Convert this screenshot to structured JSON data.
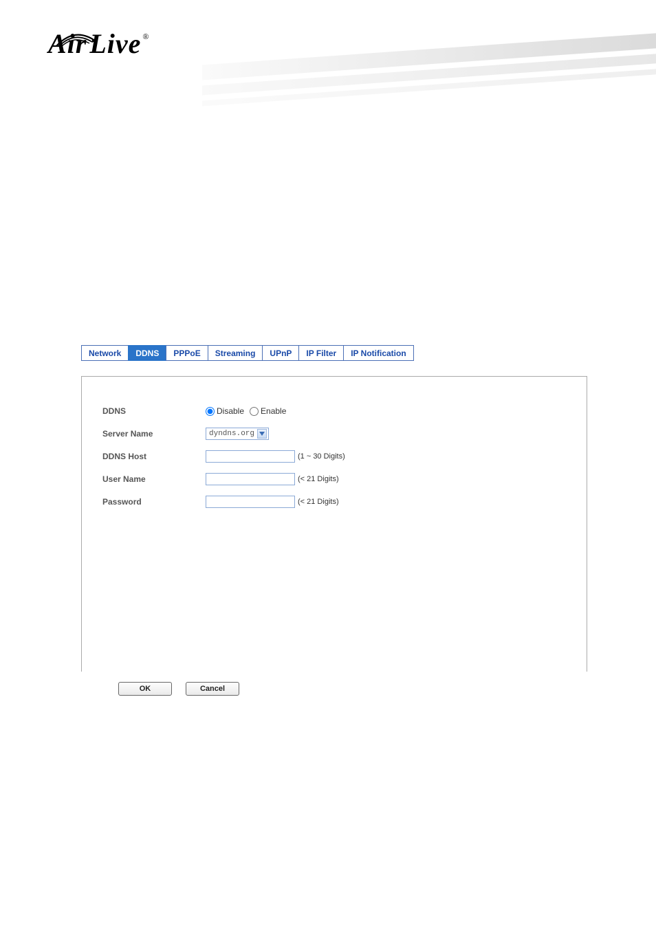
{
  "logo": {
    "brand_a": "Air",
    "brand_b": "Live",
    "reg": "®"
  },
  "tabs": {
    "items": [
      "Network",
      "DDNS",
      "PPPoE",
      "Streaming",
      "UPnP",
      "IP Filter",
      "IP Notification"
    ],
    "active_index": 1
  },
  "form": {
    "ddns": {
      "label": "DDNS",
      "disable": "Disable",
      "enable": "Enable",
      "selected": "disable"
    },
    "server_name": {
      "label": "Server Name",
      "value": "dyndns.org"
    },
    "ddns_host": {
      "label": "DDNS Host",
      "value": "",
      "hint": "(1 ~ 30 Digits)"
    },
    "user_name": {
      "label": "User Name",
      "value": "",
      "hint": "(< 21 Digits)"
    },
    "password": {
      "label": "Password",
      "value": "",
      "hint": "(< 21 Digits)"
    }
  },
  "buttons": {
    "ok": "OK",
    "cancel": "Cancel"
  }
}
